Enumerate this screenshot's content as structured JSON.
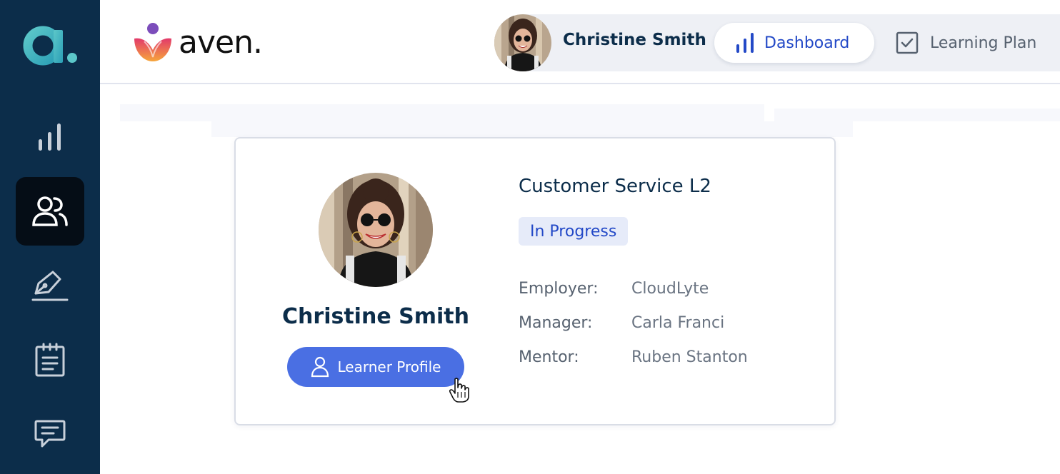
{
  "sidebar": {
    "logo_letter": "a",
    "items": [
      {
        "icon": "bar-chart-icon",
        "active": false
      },
      {
        "icon": "users-icon",
        "active": true
      },
      {
        "icon": "pen-sign-icon",
        "active": false
      },
      {
        "icon": "clipboard-icon",
        "active": false
      },
      {
        "icon": "chat-icon",
        "active": false
      }
    ]
  },
  "header": {
    "brand": "aven.",
    "user_name": "Christine Smith",
    "tabs": [
      {
        "label": "Dashboard",
        "icon": "bar-chart-icon",
        "active": true
      },
      {
        "label": "Learning Plan",
        "icon": "checkbox-icon",
        "active": false
      }
    ]
  },
  "card": {
    "name": "Christine Smith",
    "profile_button": "Learner Profile",
    "course_title": "Customer Service L2",
    "status": "In Progress",
    "details": [
      {
        "label": "Employer:",
        "value": "CloudLyte"
      },
      {
        "label": "Manager:",
        "value": "Carla Franci"
      },
      {
        "label": "Mentor:",
        "value": "Ruben Stanton"
      }
    ]
  },
  "colors": {
    "sidebar_bg": "#0c2d4a",
    "accent_blue": "#4a6fe3",
    "link_blue": "#2349c7",
    "logo_teal": "#3fb9c4"
  }
}
